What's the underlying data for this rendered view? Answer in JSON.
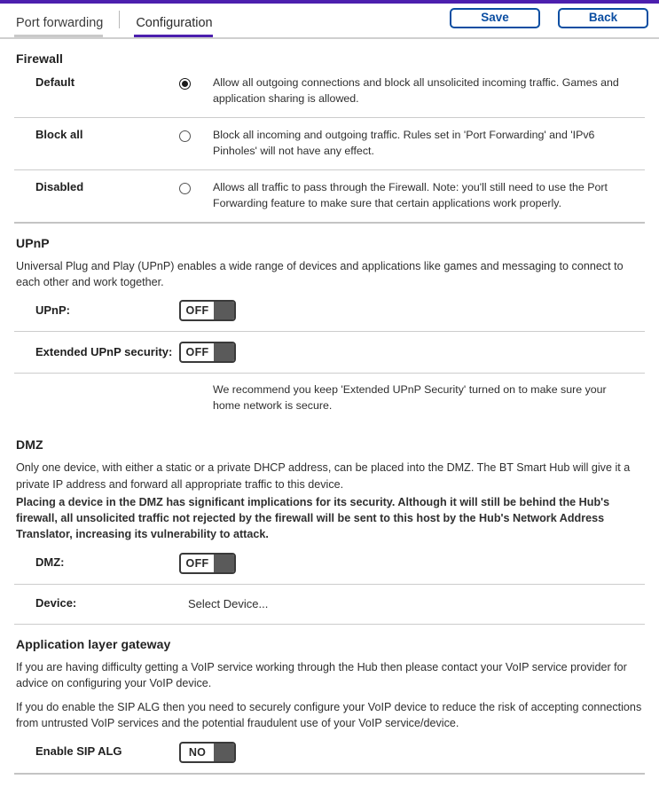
{
  "header": {
    "tabs": [
      {
        "label": "Port forwarding",
        "active": false
      },
      {
        "label": "Configuration",
        "active": true
      }
    ],
    "save_label": "Save",
    "back_label": "Back"
  },
  "firewall": {
    "title": "Firewall",
    "options": [
      {
        "label": "Default",
        "selected": true,
        "description": "Allow all outgoing connections and block all unsolicited incoming traffic. Games and application sharing is allowed."
      },
      {
        "label": "Block all",
        "selected": false,
        "description": "Block all incoming and outgoing traffic. Rules set in 'Port Forwarding' and 'IPv6 Pinholes' will not have any effect."
      },
      {
        "label": "Disabled",
        "selected": false,
        "description": "Allows all traffic to pass through the Firewall. Note: you'll still need to use the Port Forwarding feature to make sure that certain applications work properly."
      }
    ]
  },
  "upnp": {
    "title": "UPnP",
    "intro": "Universal Plug and Play (UPnP) enables a wide range of devices and applications like games and messaging to connect to each other and work together.",
    "upnp_label": "UPnP:",
    "upnp_value": "OFF",
    "extended_label": "Extended UPnP security:",
    "extended_value": "OFF",
    "note": "We recommend you keep 'Extended UPnP Security' turned on to make sure your home network is secure."
  },
  "dmz": {
    "title": "DMZ",
    "intro": "Only one device, with either a static or a private DHCP address, can be placed into the DMZ. The BT Smart Hub will give it a private IP address and forward all appropriate traffic to this device.",
    "warning": "Placing a device in the DMZ has significant implications for its security. Although it will still be behind the Hub's firewall, all unsolicited traffic not rejected by the firewall will be sent to this host by the Hub's Network Address Translator, increasing its vulnerability to attack.",
    "dmz_label": "DMZ:",
    "dmz_value": "OFF",
    "device_label": "Device:",
    "device_value": "Select Device..."
  },
  "alg": {
    "title": "Application layer gateway",
    "para1": "If you are having difficulty getting a VoIP service working through the Hub then please contact your VoIP service provider for advice on configuring your VoIP device.",
    "para2": "If you do enable the SIP ALG then you need to securely configure your VoIP device to reduce the risk of accepting connections from untrusted VoIP services and the potential fraudulent use of your VoIP service/device.",
    "sip_label": "Enable SIP ALG",
    "sip_value": "NO"
  },
  "colors": {
    "accent_purple": "#4c1fae",
    "button_blue": "#0b4ea2",
    "toggle_knob": "#5a5a5a",
    "rule_gray": "#cccccc"
  }
}
